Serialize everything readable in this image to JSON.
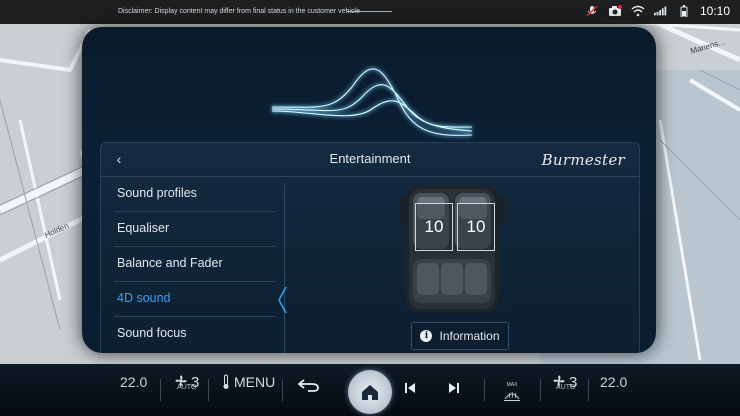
{
  "status_bar": {
    "disclaimer": "Disclaimer: Display content may differ from final status in the customer vehicle",
    "time": "10:10",
    "icons": [
      "mic-off-icon",
      "camera-icon",
      "wifi-icon",
      "signal-icon",
      "battery-icon"
    ]
  },
  "map": {
    "street_labels": [
      "Holden",
      "Mariens..."
    ]
  },
  "panel": {
    "title": "Entertainment",
    "brand": "Burmester",
    "menu": [
      {
        "label": "Sound profiles",
        "active": false
      },
      {
        "label": "Equaliser",
        "active": false
      },
      {
        "label": "Balance and Fader",
        "active": false
      },
      {
        "label": "4D sound",
        "active": true
      },
      {
        "label": "Sound focus",
        "active": false
      }
    ],
    "seat_left_value": "10",
    "seat_right_value": "10",
    "info_label": "Information"
  },
  "climate": {
    "left_temp": "22.0",
    "left_fan_level": "3",
    "left_fan_mode": "AUTO",
    "menu_label": "MENU",
    "max_label": "MAX",
    "right_fan_level": "3",
    "right_fan_mode": "AUTO",
    "right_temp": "22.0"
  },
  "colors": {
    "accent": "#3aa0f0",
    "panel_bg": "#0c2034",
    "map_bg": "#c9cfd3"
  }
}
